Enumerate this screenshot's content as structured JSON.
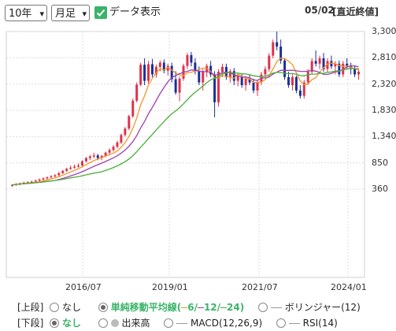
{
  "controls": {
    "period": "10年",
    "interval": "月足",
    "data_display_label": "データ表示",
    "date": "05/02",
    "price_type": "[直近終値]"
  },
  "chart_data": {
    "type": "candlestick",
    "x_tick_labels": [
      "2016/07",
      "2019/01",
      "2021/07",
      "2024/01"
    ],
    "y_tick_labels": [
      "3,300",
      "2,810",
      "2,320",
      "1,830",
      "1,340",
      "850",
      "360"
    ],
    "ylim": [
      360,
      3300
    ],
    "grid": true,
    "colors": {
      "up": "#e0304a",
      "down": "#1a2e9a",
      "ma6": "#f0962a",
      "ma12": "#a040b0",
      "ma24": "#4cae3a"
    },
    "series": [
      {
        "name": "6",
        "type": "sma",
        "months": 6
      },
      {
        "name": "12",
        "type": "sma",
        "months": 12
      },
      {
        "name": "24",
        "type": "sma",
        "months": 24
      }
    ],
    "ohlc": [
      [
        420,
        450,
        400,
        440
      ],
      [
        440,
        470,
        420,
        455
      ],
      [
        455,
        480,
        430,
        470
      ],
      [
        470,
        500,
        450,
        480
      ],
      [
        480,
        510,
        460,
        490
      ],
      [
        490,
        520,
        470,
        500
      ],
      [
        500,
        540,
        480,
        520
      ],
      [
        520,
        560,
        500,
        540
      ],
      [
        540,
        580,
        520,
        560
      ],
      [
        560,
        600,
        540,
        580
      ],
      [
        580,
        620,
        560,
        600
      ],
      [
        600,
        640,
        580,
        620
      ],
      [
        620,
        680,
        600,
        660
      ],
      [
        660,
        720,
        640,
        700
      ],
      [
        700,
        760,
        680,
        740
      ],
      [
        740,
        800,
        720,
        760
      ],
      [
        760,
        820,
        740,
        780
      ],
      [
        780,
        840,
        760,
        800
      ],
      [
        800,
        900,
        780,
        880
      ],
      [
        880,
        960,
        860,
        940
      ],
      [
        940,
        1000,
        900,
        970
      ],
      [
        970,
        1040,
        940,
        990
      ],
      [
        990,
        1020,
        900,
        940
      ],
      [
        940,
        1000,
        900,
        980
      ],
      [
        980,
        1060,
        960,
        1040
      ],
      [
        1040,
        1120,
        1000,
        1090
      ],
      [
        1090,
        1180,
        1060,
        1150
      ],
      [
        1150,
        1260,
        1120,
        1230
      ],
      [
        1230,
        1400,
        1200,
        1370
      ],
      [
        1370,
        1520,
        1340,
        1490
      ],
      [
        1490,
        1750,
        1460,
        1720
      ],
      [
        1720,
        2050,
        1690,
        2010
      ],
      [
        2010,
        2350,
        1980,
        2310
      ],
      [
        2310,
        2720,
        2280,
        2680
      ],
      [
        2680,
        2800,
        2300,
        2380
      ],
      [
        2380,
        2750,
        2330,
        2690
      ],
      [
        2690,
        2790,
        2450,
        2500
      ],
      [
        2500,
        2680,
        2440,
        2640
      ],
      [
        2640,
        2760,
        2560,
        2720
      ],
      [
        2720,
        2780,
        2520,
        2570
      ],
      [
        2570,
        2700,
        2480,
        2660
      ],
      [
        2660,
        2720,
        2350,
        2410
      ],
      [
        2410,
        2560,
        2120,
        2160
      ],
      [
        2160,
        2460,
        2000,
        2420
      ],
      [
        2420,
        2700,
        2380,
        2660
      ],
      [
        2660,
        2900,
        2600,
        2860
      ],
      [
        2860,
        2920,
        2650,
        2720
      ],
      [
        2720,
        2800,
        2500,
        2560
      ],
      [
        2560,
        2650,
        2300,
        2350
      ],
      [
        2350,
        2600,
        2200,
        2550
      ],
      [
        2550,
        2700,
        2450,
        2660
      ],
      [
        2660,
        2750,
        2450,
        2500
      ],
      [
        2500,
        2560,
        1700,
        1980
      ],
      [
        1980,
        2600,
        1900,
        2550
      ],
      [
        2550,
        2700,
        2450,
        2640
      ],
      [
        2640,
        2700,
        2400,
        2450
      ],
      [
        2450,
        2600,
        2350,
        2560
      ],
      [
        2560,
        2620,
        2300,
        2380
      ],
      [
        2380,
        2500,
        2280,
        2460
      ],
      [
        2460,
        2520,
        2250,
        2300
      ],
      [
        2300,
        2450,
        2200,
        2420
      ],
      [
        2420,
        2500,
        2300,
        2350
      ],
      [
        2350,
        2420,
        2150,
        2200
      ],
      [
        2200,
        2400,
        2100,
        2360
      ],
      [
        2360,
        2550,
        2300,
        2500
      ],
      [
        2500,
        2650,
        2450,
        2600
      ],
      [
        2600,
        2900,
        2550,
        2850
      ],
      [
        2850,
        3150,
        2800,
        3100
      ],
      [
        3100,
        3300,
        2950,
        3020
      ],
      [
        3020,
        3150,
        2700,
        2760
      ],
      [
        2760,
        2800,
        2400,
        2450
      ],
      [
        2450,
        2550,
        2250,
        2300
      ],
      [
        2300,
        2500,
        2200,
        2450
      ],
      [
        2450,
        2480,
        2150,
        2200
      ],
      [
        2200,
        2300,
        2050,
        2100
      ],
      [
        2100,
        2400,
        2050,
        2350
      ],
      [
        2350,
        2600,
        2300,
        2550
      ],
      [
        2550,
        2800,
        2500,
        2750
      ],
      [
        2750,
        2950,
        2650,
        2700
      ],
      [
        2700,
        2850,
        2600,
        2800
      ],
      [
        2800,
        2900,
        2550,
        2600
      ],
      [
        2600,
        2800,
        2550,
        2750
      ],
      [
        2750,
        2850,
        2600,
        2650
      ],
      [
        2650,
        2750,
        2500,
        2700
      ],
      [
        2700,
        2760,
        2450,
        2500
      ],
      [
        2500,
        2750,
        2450,
        2700
      ],
      [
        2700,
        2800,
        2600,
        2650
      ],
      [
        2650,
        2720,
        2500,
        2600
      ],
      [
        2600,
        2660,
        2450,
        2500
      ],
      [
        2500,
        2600,
        2400,
        2550
      ]
    ]
  },
  "legend_bar": {
    "upper_label": "[上段]",
    "lower_label": "[下段]",
    "upper_options": [
      "なし",
      "単純移動平均線",
      "ボリンジャー(12)"
    ],
    "sma_open": "(",
    "sma_6": "6",
    "sma_sep1": "/",
    "sma_12": "12",
    "sma_sep2": "/",
    "sma_24": "24",
    "sma_close": ")",
    "lower_options": [
      "なし",
      "出来高",
      "MACD(12,26,9)",
      "RSI(14)"
    ],
    "upper_selected": "単純移動平均線",
    "lower_selected": "なし"
  }
}
